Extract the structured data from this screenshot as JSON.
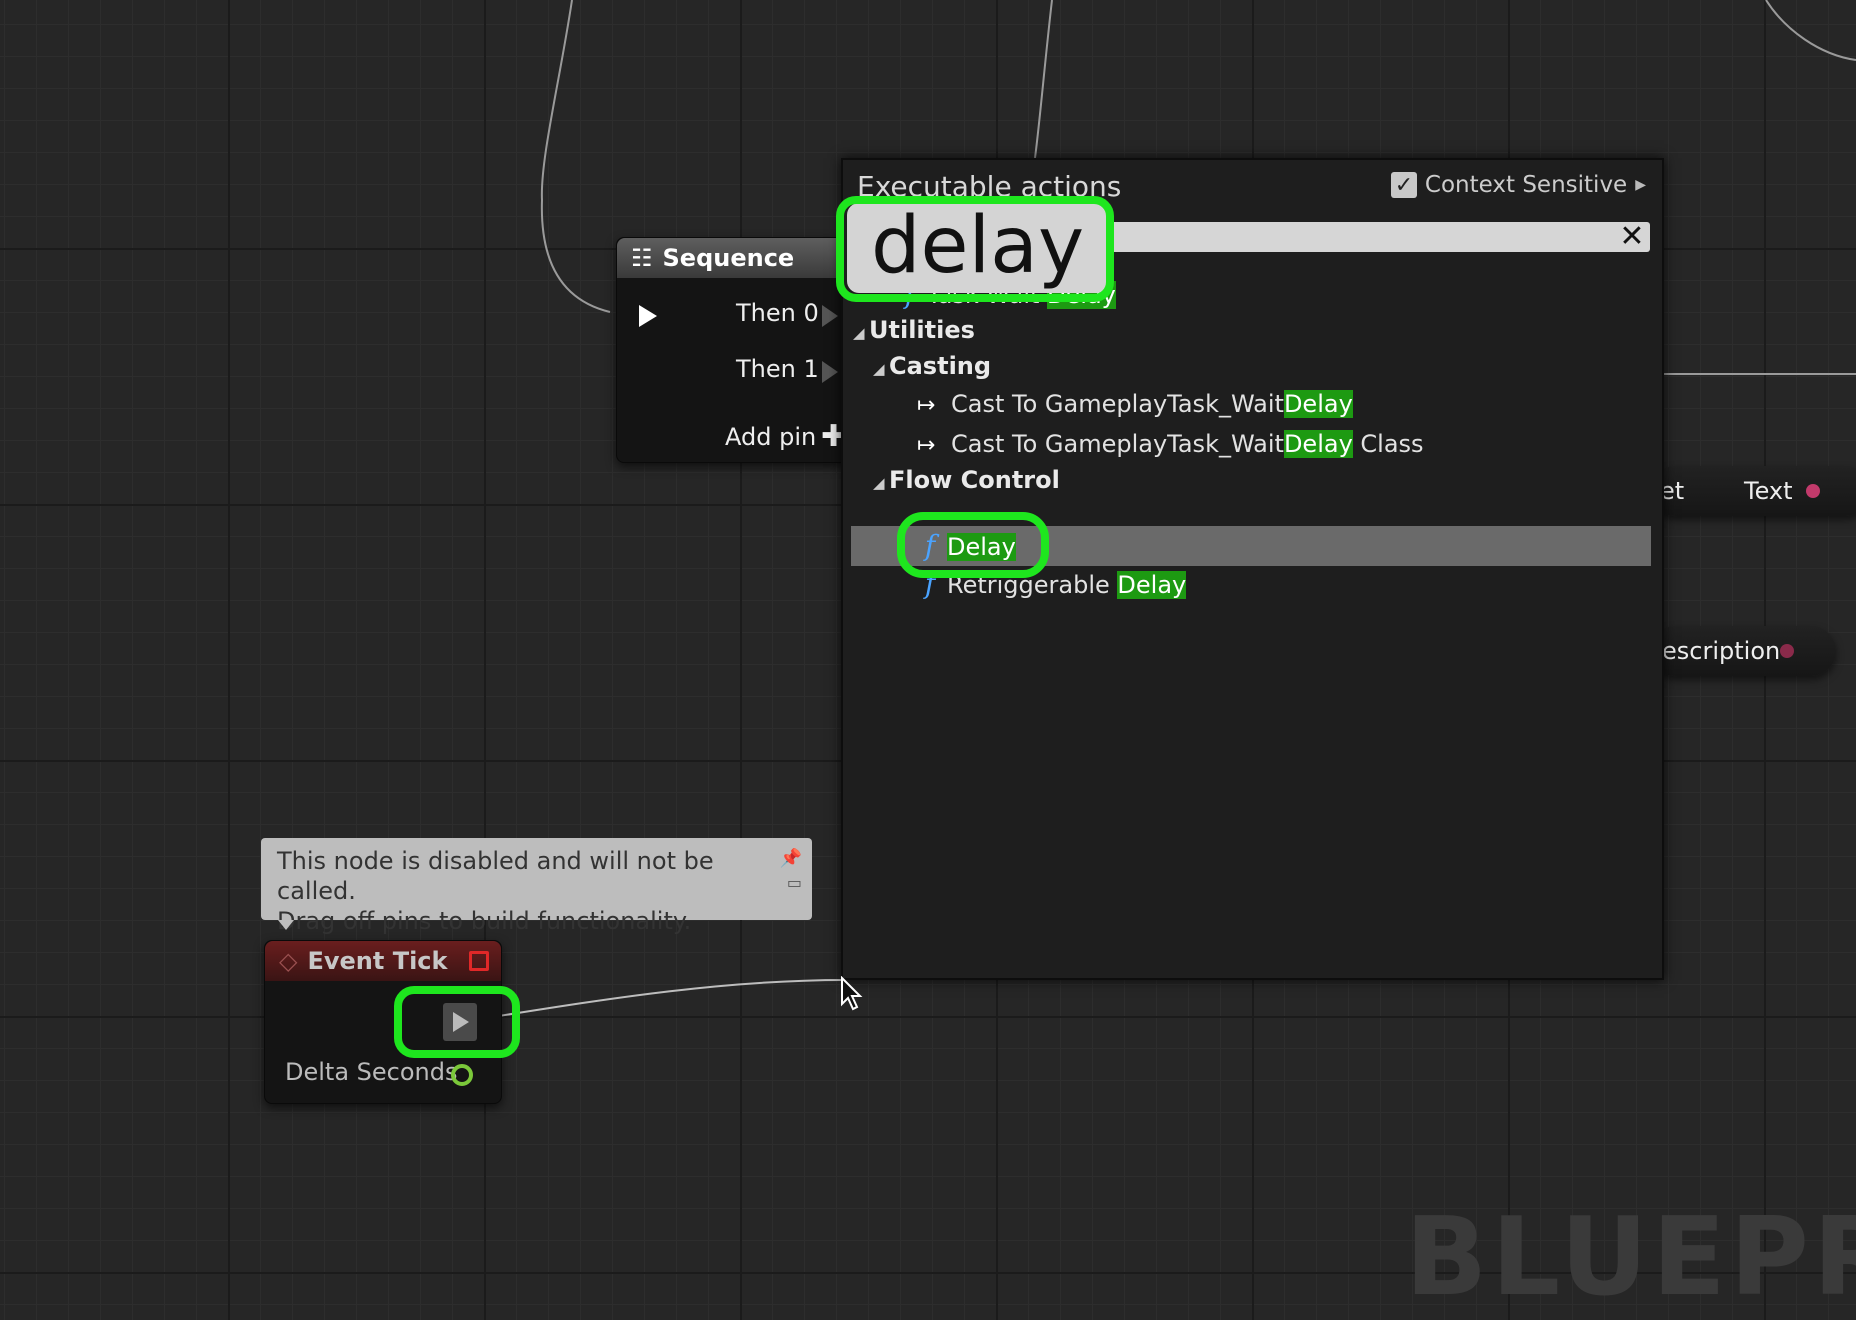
{
  "palette": {
    "title": "Executable actions",
    "context_sensitive_label": "Context Sensitive",
    "search_value": "delay",
    "clear_icon": "close-icon",
    "results": [
      {
        "type": "function",
        "pre": "Task Wait ",
        "match": "Delay",
        "post": ""
      },
      {
        "type": "category",
        "label": "Utilities"
      },
      {
        "type": "subcategory",
        "label": "Casting"
      },
      {
        "type": "cast",
        "pre": "Cast To GameplayTask_Wait",
        "match": "Delay",
        "post": ""
      },
      {
        "type": "cast",
        "pre": "Cast To GameplayTask_Wait",
        "match": "Delay",
        "post": " Class"
      },
      {
        "type": "subcategory",
        "label": "Flow Control"
      },
      {
        "type": "function",
        "pre": "",
        "match": "Delay",
        "post": "",
        "selected": true
      },
      {
        "type": "function",
        "pre": "Retriggerable ",
        "match": "Delay",
        "post": ""
      }
    ]
  },
  "sequence_node": {
    "title": "Sequence",
    "then0": "Then 0",
    "then1": "Then 1",
    "add_pin": "Add pin"
  },
  "comment": {
    "line1": "This node is disabled and will not be called.",
    "line2": "Drag off pins to build functionality."
  },
  "event_node": {
    "title": "Event Tick",
    "delta": "Delta Seconds"
  },
  "right_nodes": {
    "pill1_left": "et",
    "pill1_right": "Text",
    "pill2": "escription"
  },
  "watermark": "BLUEPRI",
  "colors": {
    "highlight": "#1d9a12",
    "callout": "#1ee61e",
    "function_icon": "#4aa3ff"
  }
}
